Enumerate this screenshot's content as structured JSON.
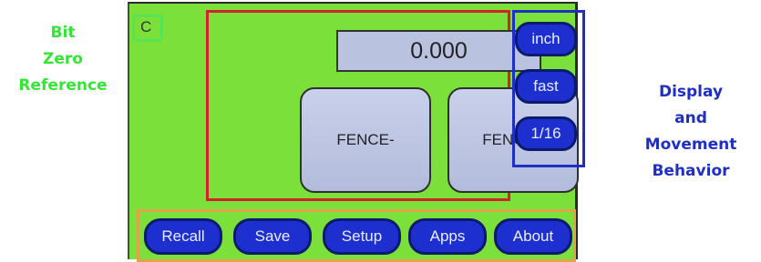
{
  "callouts": {
    "left": [
      "Bit",
      "Zero",
      "Reference"
    ],
    "right": [
      "Display",
      "and",
      "Movement",
      "Behavior"
    ]
  },
  "screen": {
    "bit_zero_label": "C",
    "readout": "0.000",
    "fence_minus": "FENCE-",
    "fence_plus": "FENCE+",
    "side_buttons": {
      "units": "inch",
      "speed": "fast",
      "fraction": "1/16"
    },
    "nav": [
      "Recall",
      "Save",
      "Setup",
      "Apps",
      "About"
    ]
  },
  "colors": {
    "screen_background": "#7be03a",
    "button_blue": "#1e2fd0",
    "bit_zero_outline": "#56e456",
    "fence_outline": "#d3232a",
    "display_outline": "#1f2fc4",
    "nav_outline": "#e0a24a"
  }
}
